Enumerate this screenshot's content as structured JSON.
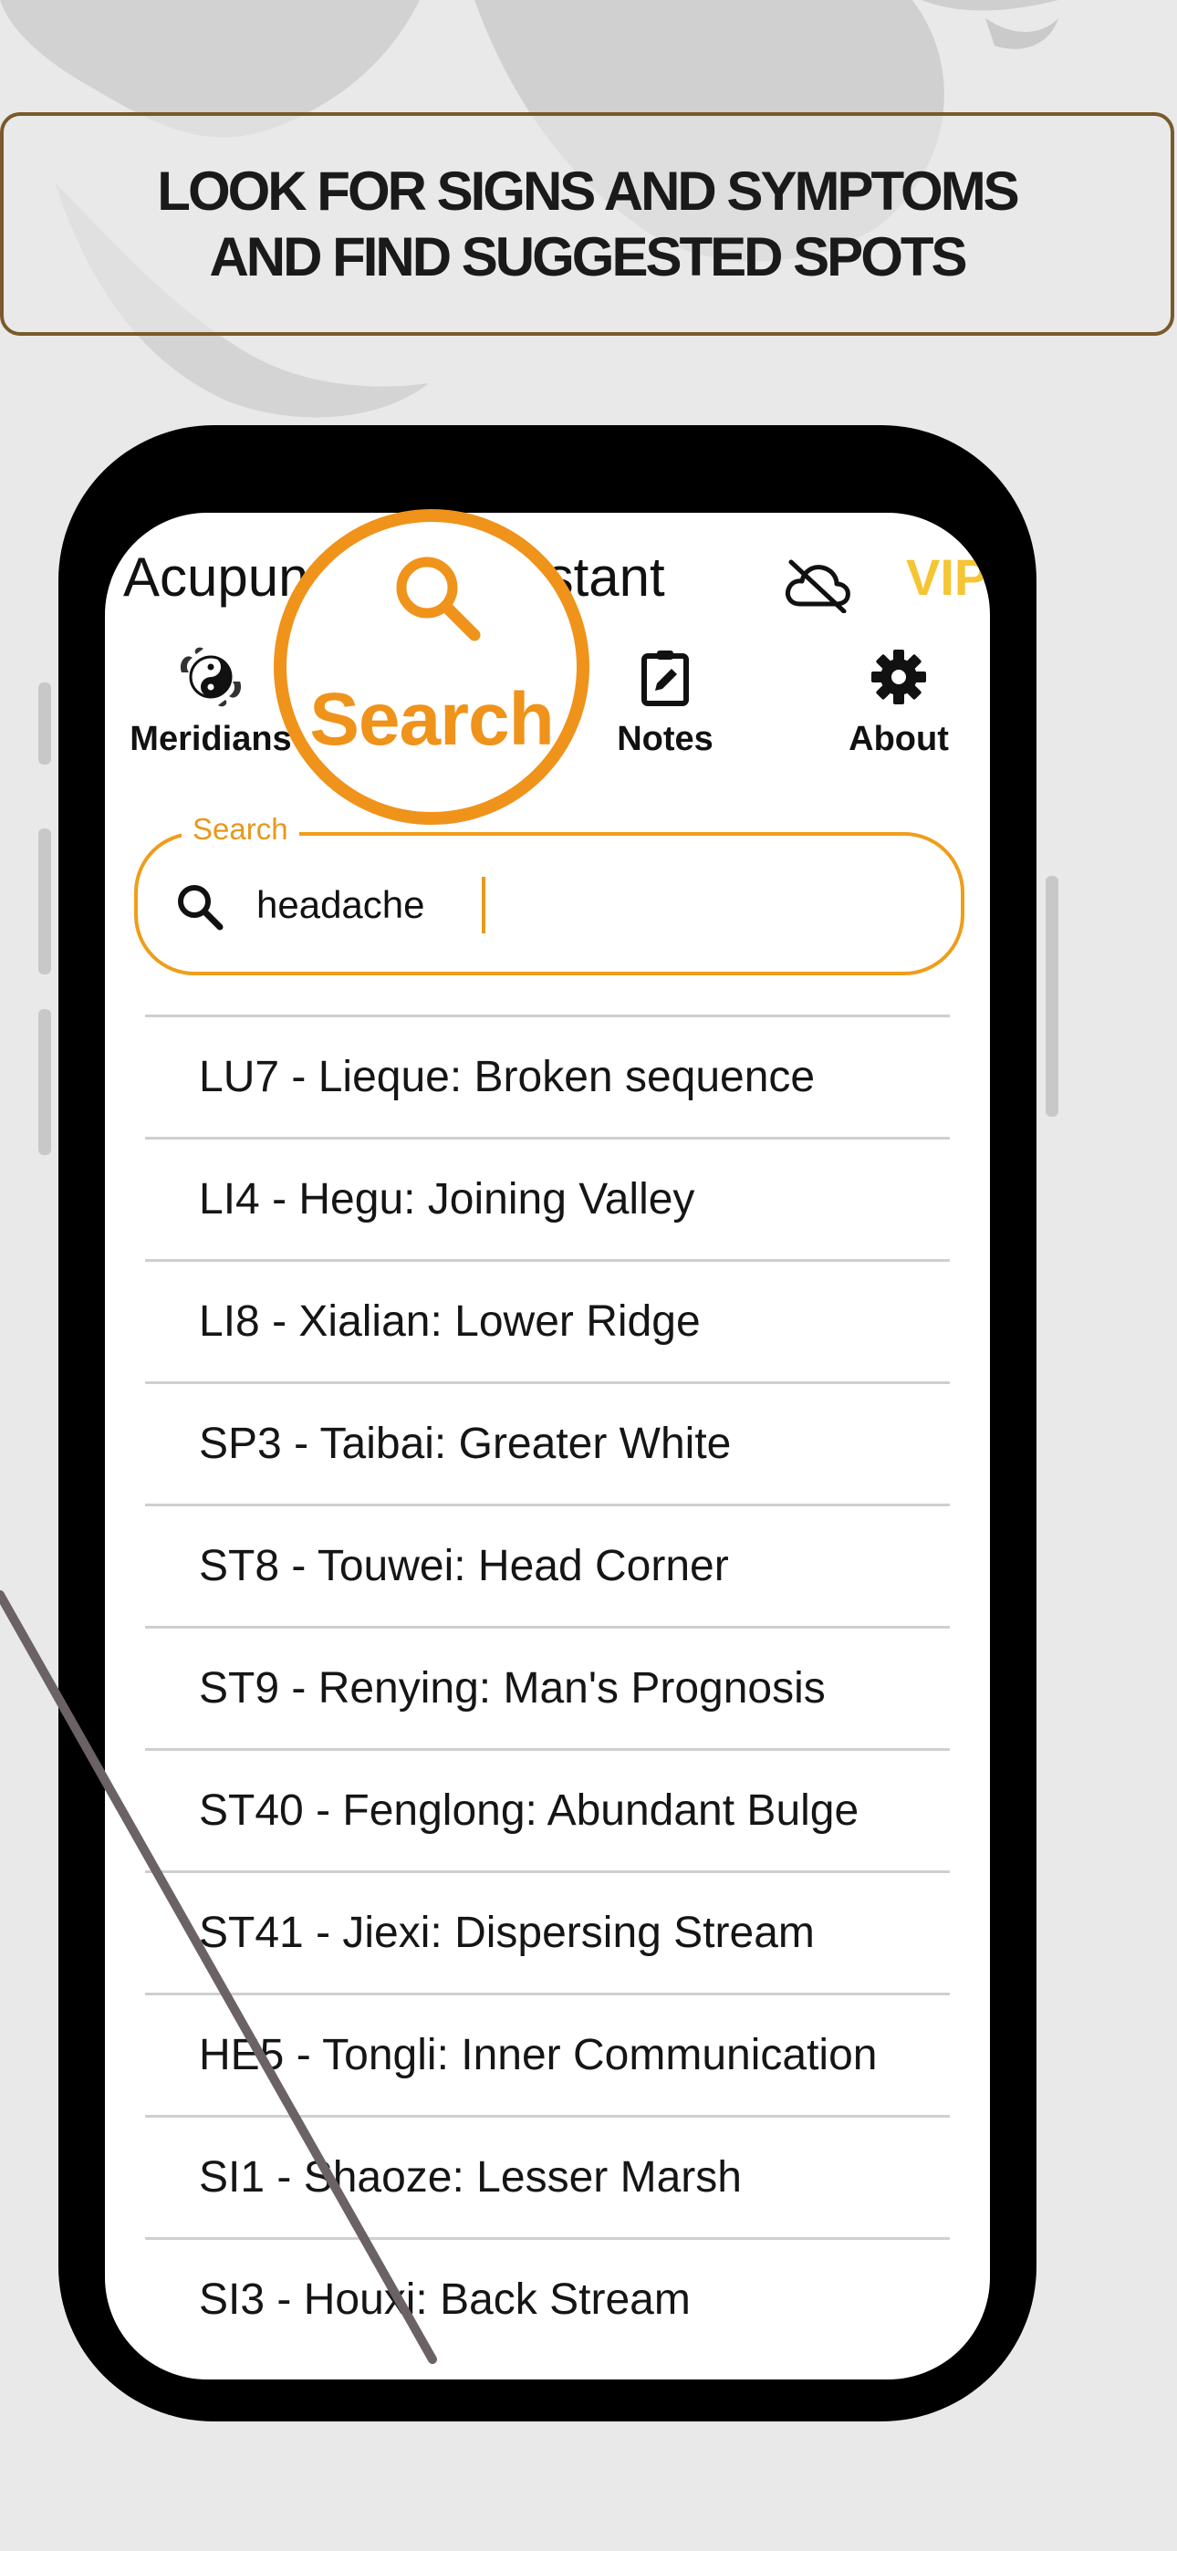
{
  "banner": {
    "line1": "LOOK FOR SIGNS AND SYMPTOMS",
    "line2": "AND FIND SUGGESTED SPOTS"
  },
  "app": {
    "title": "Acupuncture Assistant",
    "vip_label": "VIP",
    "cloud_icon": "cloud-off-icon"
  },
  "tabs": [
    {
      "label": "Meridians",
      "icon": "yin-yang-icon"
    },
    {
      "label": "Search",
      "icon": "search-icon"
    },
    {
      "label": "Notes",
      "icon": "clipboard-edit-icon"
    },
    {
      "label": "About",
      "icon": "gear-icon"
    }
  ],
  "search": {
    "label": "Search",
    "value": "headache"
  },
  "results": [
    "LU7 - Lieque: Broken sequence",
    "LI4 - Hegu: Joining Valley",
    "LI8 - Xialian: Lower Ridge",
    "SP3 - Taibai: Greater White",
    "ST8 - Touwei: Head Corner",
    "ST9 - Renying: Man's Prognosis",
    "ST40 - Fenglong: Abundant Bulge",
    "ST41 - Jiexi: Dispersing Stream",
    "HE5 - Tongli: Inner Communication",
    "SI1 - Shaoze: Lesser Marsh",
    "SI3 - Houxi: Back Stream"
  ],
  "colors": {
    "accent": "#ef931b",
    "vip": "#f5c533",
    "banner_border": "#7a5a2a",
    "background": "#e9e9e9"
  }
}
